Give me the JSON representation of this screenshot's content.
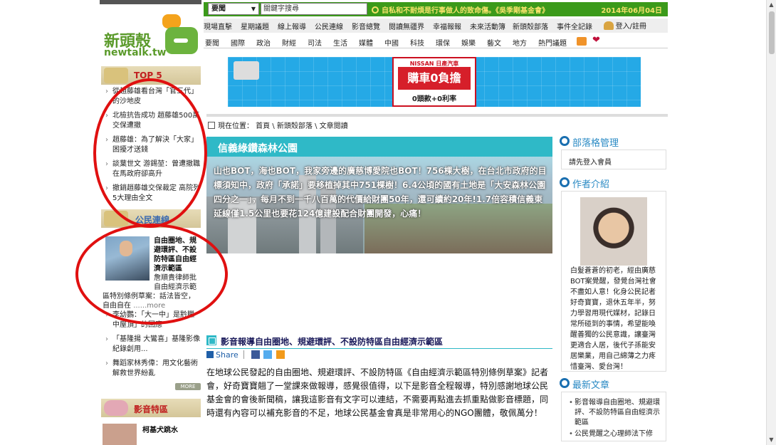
{
  "colors": {
    "brand_green": "#3b9a1a",
    "accent_yellow": "#f6e36a",
    "annotation_red": "#e01010",
    "teal": "#2fb9c7"
  },
  "logo": {
    "text": "新頭殼",
    "sub": "newtalk.tw"
  },
  "topbar": {
    "select_value": "要聞",
    "search_value": "關鍵字搜尋",
    "slogan": "自私和不耐煩是行事做人的致命傷。《吳季剛基金會》",
    "date": "2014年06月04日"
  },
  "nav1": [
    "現場直擊",
    "星期議題",
    "線上報導",
    "公民連線",
    "影音總覽",
    "閱讀無疆界",
    "幸福報報",
    "未來活動簿",
    "新頭殼部落",
    "事件全記錄"
  ],
  "login": "登入/註冊",
  "nav2": [
    "要聞",
    "國際",
    "政治",
    "財經",
    "司法",
    "生活",
    "媒體",
    "中國",
    "科技",
    "環保",
    "娛樂",
    "藝文",
    "地方",
    "熱門議題"
  ],
  "banner": {
    "brand": "NISSAN 日產汽車",
    "headline": "購車0負擔",
    "sub": "0頭款+0利率"
  },
  "breadcrumb": "現在位置： 首頁 \\ 新頭殼部落 \\ 文章閱讀",
  "top5": {
    "title": "TOP 5",
    "items": [
      "從趙藤雄看台灣「官三代」的沙地皮",
      "北檢抗告成功 趙藤雄500萬交保遭撤",
      "趙藤雄：為了解決「大家」困擾才送錢",
      "談葉世文 游錫堃：曾遭撤職在馬政府卻高升",
      "撤銷趙藤雄交保裁定 高院列5大理由全文"
    ]
  },
  "citizen": {
    "title": "公民連線",
    "feature_title": "自由圈地、規避環評、不設防特區自由經濟示範區",
    "feature_desc": "詹順貴律師批自由經濟示範",
    "feature_cont": "區特別條例草案：話法皆空，自由自在",
    "more_link": "......more",
    "items": [
      "李幼鸚：「大一中」是黔臘中屋頂」的回應",
      "「基隆揚 大鸞喜」基隆影像紀錄創用...",
      "舞蹈家林秀偉：用文化藝術解救世界紛亂"
    ],
    "more_btn": "MORE"
  },
  "video": {
    "title": "影音特區",
    "item": "柯基犬跳水"
  },
  "hero": {
    "title": "信義綠鑽森林公園",
    "caption": "山也BOT，海也BOT，我家旁邊的廣慈博愛院也BOT！756棵大樹，在台北市政府的目標須知中，政府「承諾」要移植掉其中751棵樹！6.4公頃的國有土地是「大安森林公園四分之一」，每月不到一千八百萬的代價給財團50年，還可續約20年!1.7倍容積信義東延線僅1.5公里也要花124億建設配合財團開發，心痛！"
  },
  "article": {
    "title": "影音報導自由圈地、規避環評、不設防特區自由經濟示範區",
    "share": "Share",
    "body": "在地球公民發起的自由圈地、規避環評、不設防特區《自由經濟示範區特別條例草案》記者會，好奇寶寶翹了一堂課來做報導，感覺很值得，以下是影音全程報導，特別感謝地球公民基金會的會後新聞稿，讓我這影音有文字可以連結，不需要再點進去抓重點做影音標題，同時還有內容可以補充影音的不足，地球公民基金會真是非常用心的NGO團體，敬佩萬分！"
  },
  "right": {
    "blog_mgmt": "部落格管理",
    "login_link": "請先登入會員",
    "author_head": "作者介紹",
    "author_desc": "白髮蒼蒼的初老，經由廣慈BOT案覺醒，發覺台灣社會不盡如人意！化身公民記者好奇寶寶，退休五年半，努力學習用現代媒材，記錄日常所碰到的事情，希望能喚醒善獨的公民意識，讓臺灣更適合人居，後代子孫能安居樂業，用自己綿薄之力疼惜臺灣、愛台灣！",
    "latest_head": "最新文章",
    "latest": [
      "影音報導自由圈地、規避環評、不設防特區自由經濟示範區",
      "公民覺醒之心理師法下修"
    ]
  }
}
